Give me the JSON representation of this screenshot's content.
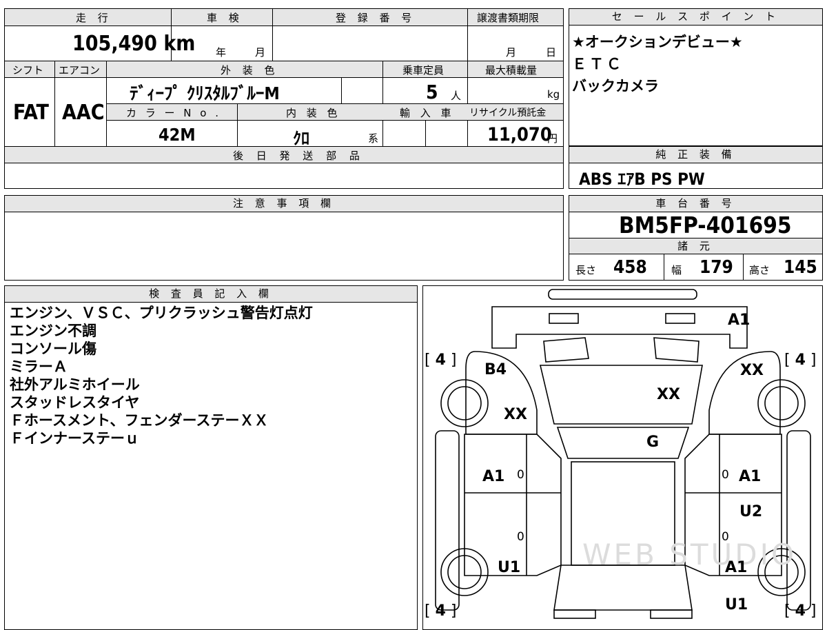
{
  "top_left": {
    "mileage_header": "走 行",
    "mileage_value": "105,490 km",
    "inspection_header": "車 検",
    "inspection_year_unit": "年",
    "inspection_month_unit": "月",
    "registration_header": "登 録 番 号",
    "transfer_deadline_header": "譲渡書類期限",
    "transfer_month_unit": "月",
    "transfer_day_unit": "日",
    "shift_header": "シフト",
    "shift_value": "FAT",
    "ac_header": "エアコン",
    "ac_value": "AAC",
    "exterior_color_header": "外 装 色",
    "exterior_color_value": "ﾃﾞｨｰﾌﾟ ｸﾘｽﾀﾙﾌﾞﾙｰM",
    "capacity_header": "乗車定員",
    "capacity_value": "5",
    "capacity_unit": "人",
    "max_load_header": "最大積載量",
    "max_load_unit": "kg",
    "color_no_header": "カ ラ ー N o .",
    "color_no_value": "42M",
    "interior_color_header": "内 装 色",
    "interior_color_value": "ｸﾛ",
    "interior_color_suffix": "系",
    "import_header": "輸 入 車",
    "recycle_header": "リサイクル預託金",
    "recycle_value": "11,070",
    "recycle_unit": "円",
    "later_parts_header": "後 日 発 送 部 品"
  },
  "sales_points": {
    "header": "セ ー ル ス ポ イ ン ト",
    "items": [
      "★オークションデビュー★",
      "ＥＴＣ",
      "バックカメラ"
    ]
  },
  "standard_equipment": {
    "header": "純 正 装 備",
    "value": "ABS ｴｱB PS PW"
  },
  "notes": {
    "header": "注 意 事 項 欄"
  },
  "chassis": {
    "header": "車 台 番 号",
    "value": "BM5FP-401695",
    "spec_header": "諸 元",
    "length_label": "長さ",
    "length_value": "458",
    "width_label": "幅",
    "width_value": "179",
    "height_label": "高さ",
    "height_value": "145"
  },
  "inspector": {
    "header": "検 査 員 記 入 欄",
    "lines": [
      "エンジン、ＶＳＣ、プリクラッシュ警告灯点灯",
      "エンジン不調",
      "コンソール傷",
      "ミラーＡ",
      "社外アルミホイール",
      "スタッドレスタイヤ",
      "Ｆホースメント、フェンダーステーＸＸ",
      "Ｆインナーステーｕ"
    ]
  },
  "diagram": {
    "marks": {
      "front_bumper": "A1",
      "front_left": "B4",
      "front_right": "XX",
      "left_fender": "XX",
      "hood": "XX",
      "windshield": "G",
      "left_front_door": "A1",
      "right_front_door": "A1",
      "right_rear_door": "U2",
      "left_rear": "U1",
      "right_rear": "A1",
      "right_rear_bottom": "U1"
    },
    "door_zero_marks": [
      "0",
      "0",
      "0",
      "0"
    ],
    "tire_depth_fl": "4",
    "tire_depth_fr": "4",
    "tire_depth_rl": "4",
    "tire_depth_rr": "4",
    "watermark": "WEB STUDIO"
  }
}
